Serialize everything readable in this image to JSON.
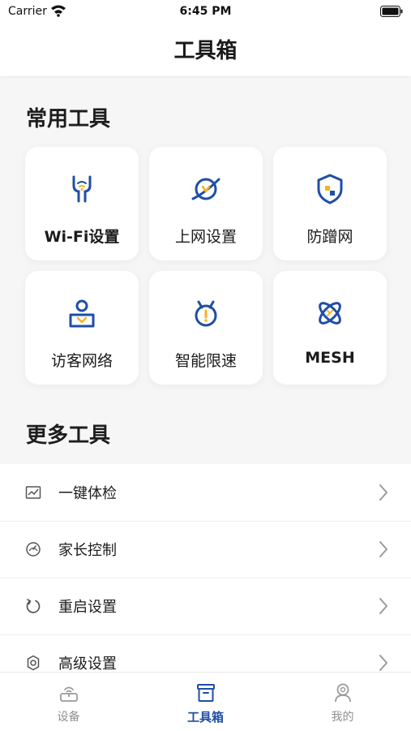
{
  "status_bar": {
    "carrier": "Carrier",
    "time": "6:45 PM"
  },
  "nav": {
    "title": "工具箱"
  },
  "common_tools": {
    "title": "常用工具",
    "items": [
      {
        "label": "Wi-Fi设置",
        "icon": "wifi-settings-icon"
      },
      {
        "label": "上网设置",
        "icon": "internet-settings-icon"
      },
      {
        "label": "防蹭网",
        "icon": "anti-freeloading-shield-icon"
      },
      {
        "label": "访客网络",
        "icon": "guest-network-icon"
      },
      {
        "label": "智能限速",
        "icon": "smart-speed-limit-icon"
      },
      {
        "label": "MESH",
        "icon": "mesh-icon"
      }
    ]
  },
  "more_tools": {
    "title": "更多工具",
    "items": [
      {
        "label": "一键体检",
        "icon": "health-check-icon"
      },
      {
        "label": "家长控制",
        "icon": "parental-control-icon"
      },
      {
        "label": "重启设置",
        "icon": "restart-icon"
      },
      {
        "label": "高级设置",
        "icon": "advanced-settings-gear-icon"
      }
    ]
  },
  "tabbar": {
    "items": [
      {
        "label": "设备",
        "icon": "router-device-icon",
        "active": false
      },
      {
        "label": "工具箱",
        "icon": "toolbox-icon",
        "active": true
      },
      {
        "label": "我的",
        "icon": "profile-icon",
        "active": false
      }
    ]
  },
  "colors": {
    "accent": "#1f4ea6",
    "highlight": "#f5b324",
    "background": "#f6f6f7"
  }
}
